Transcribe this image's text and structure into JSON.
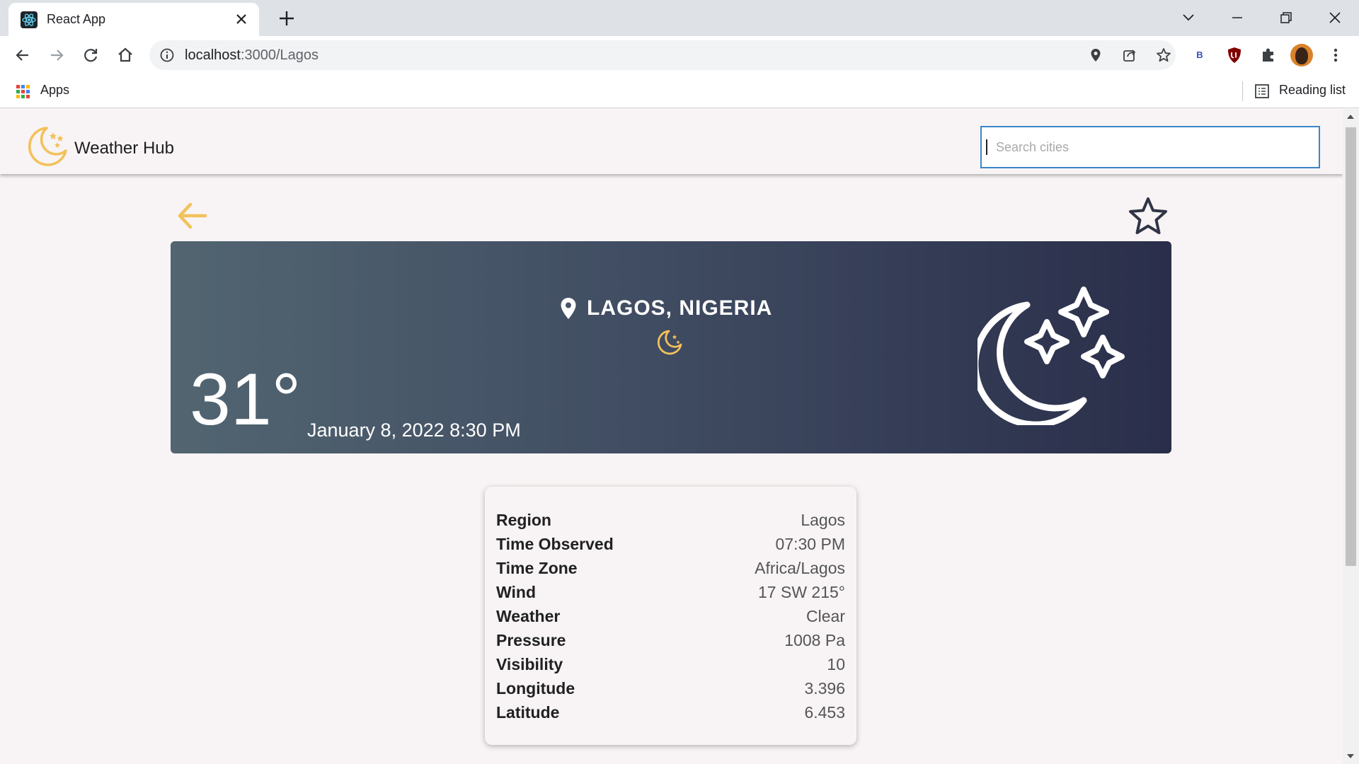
{
  "browser": {
    "tab_title": "React App",
    "url_host": "localhost",
    "url_path": ":3000/Lagos",
    "bookmarks_apps": "Apps",
    "reading_list": "Reading list",
    "extension_b_label": "B"
  },
  "app": {
    "brand": "Weather Hub",
    "search_placeholder": "Search cities"
  },
  "weather": {
    "location": "Lagos, Nigeria",
    "temperature": "31°",
    "datetime": "January 8, 2022 8:30 PM",
    "condition_icon": "moon-stars-icon"
  },
  "details": [
    {
      "label": "Region",
      "value": "Lagos"
    },
    {
      "label": "Time Observed",
      "value": "07:30 PM"
    },
    {
      "label": "Time Zone",
      "value": "Africa/Lagos"
    },
    {
      "label": "Wind",
      "value": "17 SW 215°"
    },
    {
      "label": "Weather",
      "value": "Clear"
    },
    {
      "label": "Pressure",
      "value": "1008 Pa"
    },
    {
      "label": "Visibility",
      "value": "10"
    },
    {
      "label": "Longitude",
      "value": "3.396"
    },
    {
      "label": "Latitude",
      "value": "6.453"
    }
  ],
  "colors": {
    "accent": "#f3c15a",
    "hero_gradient_start": "#526571",
    "hero_gradient_end": "#2a2e4a",
    "page_bg": "#f8f4f5"
  }
}
